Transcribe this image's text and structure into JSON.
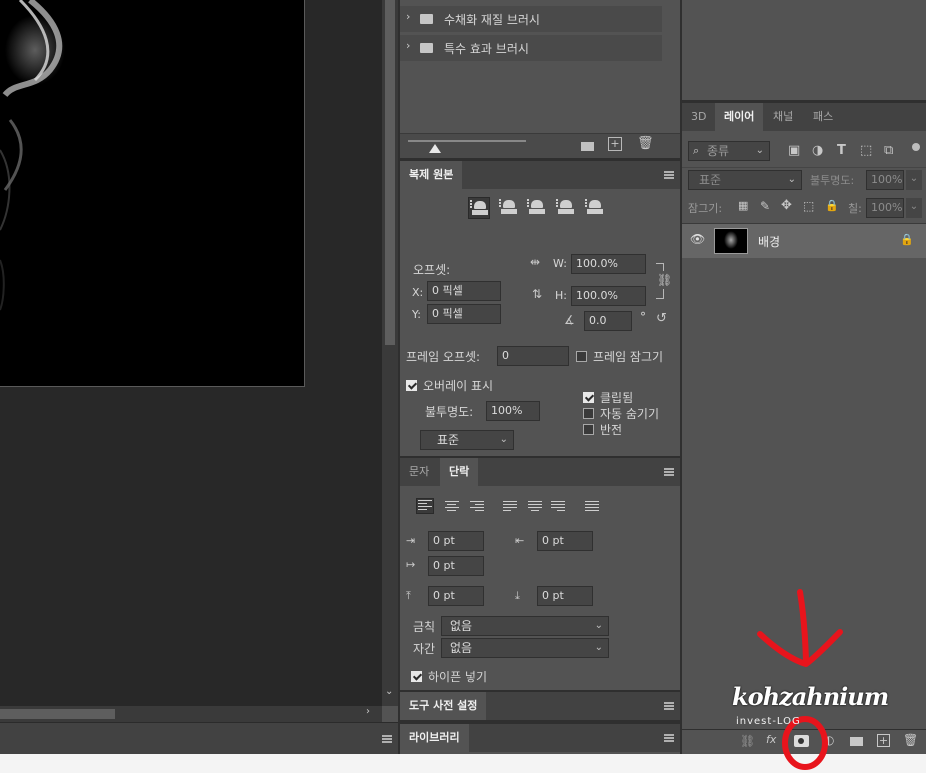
{
  "brushes": {
    "folder1": "수채화 재질 브러시",
    "folder2": "특수 효과 브러시"
  },
  "clone_source": {
    "tab": "복제 원본",
    "offset_label": "오프셋:",
    "x_label": "X:",
    "x_value": "0 픽셀",
    "y_label": "Y:",
    "y_value": "0 픽셀",
    "w_label": "W:",
    "w_value": "100.0%",
    "h_label": "H:",
    "h_value": "100.0%",
    "angle_value": "0.0",
    "deg": "°",
    "frame_offset_label": "프레임 오프셋:",
    "frame_offset_value": "0",
    "frame_lock_label": "프레임 잠그기",
    "overlay_label": "오버레이 표시",
    "opacity_label": "불투명도:",
    "opacity_value": "100%",
    "blend_value": "표준",
    "clipped_label": "클립됨",
    "autohide_label": "자동 숨기기",
    "invert_label": "반전"
  },
  "paragraph": {
    "tab_char": "문자",
    "tab_para": "단락",
    "indent_left": "0 pt",
    "indent_right": "0 pt",
    "indent_first": "0 pt",
    "space_before": "0 pt",
    "space_after": "0 pt",
    "kinsoku_label": "금칙",
    "kinsoku_value": "없음",
    "mojikumi_label": "자간",
    "mojikumi_value": "없음",
    "hyphenate_label": "하이픈 넣기"
  },
  "tool_presets": {
    "tab": "도구 사전 설정"
  },
  "library": {
    "tab": "라이브러리"
  },
  "layers": {
    "tab_3d": "3D",
    "tab_layers": "레이어",
    "tab_channels": "채널",
    "tab_paths": "패스",
    "filter_value": "종류",
    "blend_mode": "표준",
    "opacity_label": "불투명도:",
    "opacity_value": "100%",
    "lock_label": "잠그기:",
    "fill_label": "칠:",
    "fill_value": "100%",
    "layer_name": "배경"
  },
  "watermark": {
    "main": "kohzahnium",
    "sub": "invest-LOG"
  },
  "colors": {
    "annotation": "#e8141c"
  }
}
